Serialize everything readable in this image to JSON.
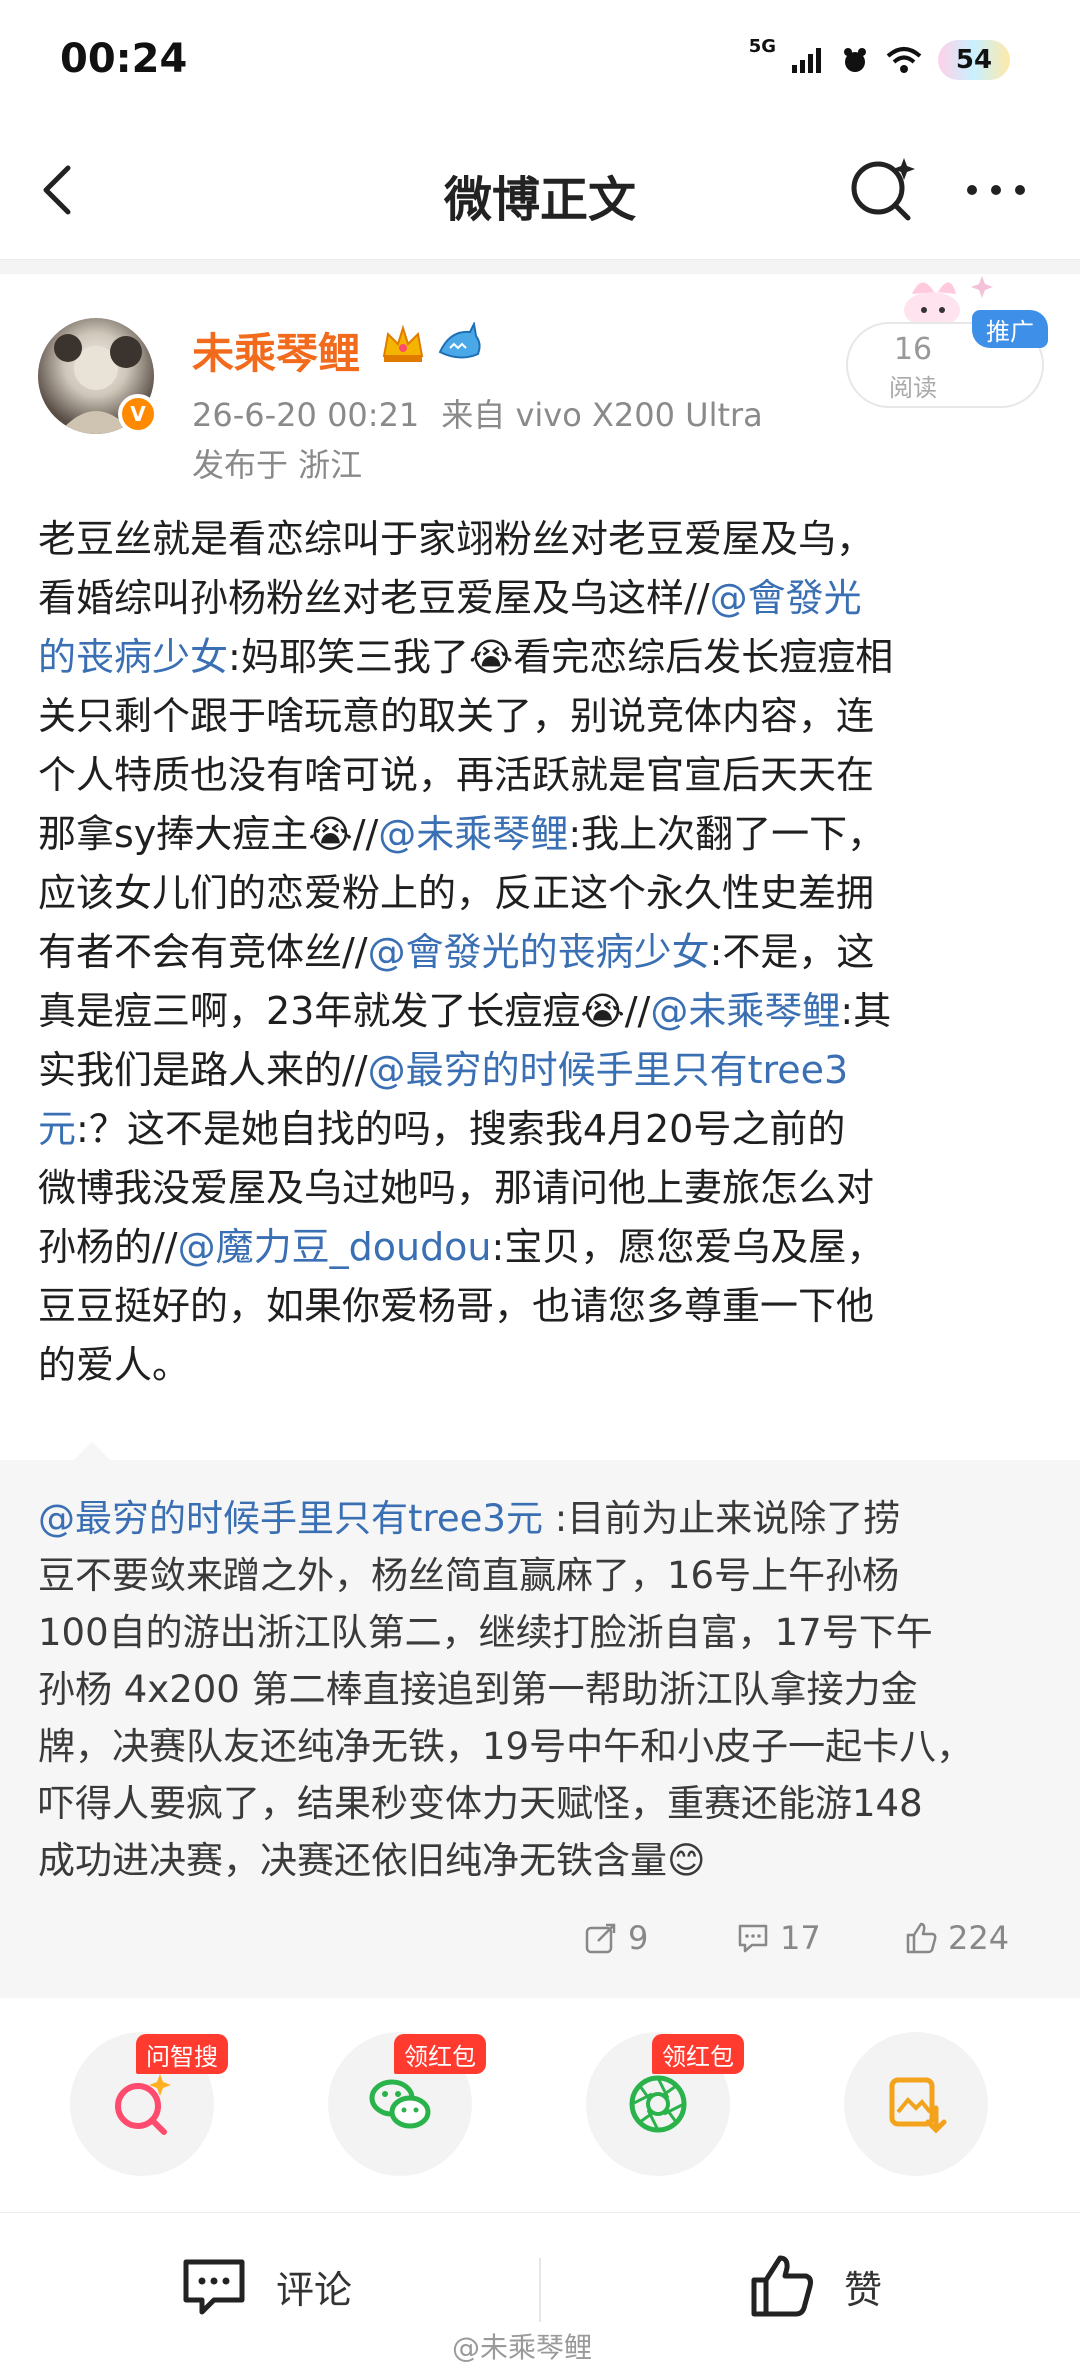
{
  "status_bar": {
    "time": "00:24",
    "network": "5G",
    "battery": "54"
  },
  "header": {
    "title": "微博正文"
  },
  "author": {
    "name": "未乘琴鲤",
    "timestamp": "26-6-20 00:21",
    "source": "来自 vivo X200 Ultra",
    "location": "发布于 浙江"
  },
  "stats_box": {
    "count": "16",
    "label": "阅读",
    "promo": "推广"
  },
  "post": {
    "lines": [
      [
        {
          "t": "老豆丝就是看恋综叫于家翊粉丝对老豆爱屋及乌，"
        }
      ],
      [
        {
          "t": "看婚综叫孙杨粉丝对老豆爱屋及乌这样//"
        },
        {
          "t": "@會發光",
          "at": true
        }
      ],
      [
        {
          "t": "的丧病少女",
          "at": true
        },
        {
          "t": ":妈耶笑三我了😭看完恋综后发长痘痘相"
        }
      ],
      [
        {
          "t": "关只剩个跟于啥玩意的取关了，别说竞体内容，连"
        }
      ],
      [
        {
          "t": "个人特质也没有啥可说，再活跃就是官宣后天天在"
        }
      ],
      [
        {
          "t": "那拿sy捧大痘主😭//"
        },
        {
          "t": "@未乘琴鲤",
          "at": true
        },
        {
          "t": ":我上次翻了一下，"
        }
      ],
      [
        {
          "t": "应该女儿们的恋爱粉上的，反正这个永久性史差拥"
        }
      ],
      [
        {
          "t": "有者不会有竞体丝//"
        },
        {
          "t": "@會發光的丧病少女",
          "at": true
        },
        {
          "t": ":不是，这"
        }
      ],
      [
        {
          "t": "真是痘三啊，23年就发了长痘痘😭//"
        },
        {
          "t": "@未乘琴鲤",
          "at": true
        },
        {
          "t": ":其"
        }
      ],
      [
        {
          "t": "实我们是路人来的//"
        },
        {
          "t": "@最穷的时候手里只有tree3",
          "at": true
        }
      ],
      [
        {
          "t": "元",
          "at": true
        },
        {
          "t": ":？这不是她自找的吗，搜索我4月20号之前的"
        }
      ],
      [
        {
          "t": "微博我没爱屋及乌过她吗，那请问他上妻旅怎么对"
        }
      ],
      [
        {
          "t": "孙杨的//"
        },
        {
          "t": "@魔力豆_doudou",
          "at": true
        },
        {
          "t": ":宝贝，愿您爱乌及屋，"
        }
      ],
      [
        {
          "t": "豆豆挺好的，如果你爱杨哥，也请您多尊重一下他"
        }
      ],
      [
        {
          "t": "的爱人。"
        }
      ]
    ]
  },
  "quoted": {
    "lines": [
      [
        {
          "t": "@最穷的时候手里只有tree3元",
          "at": true
        },
        {
          "t": " :目前为止来说除了捞"
        }
      ],
      [
        {
          "t": "豆不要敛来蹭之外，杨丝简直赢麻了，16号上午孙杨"
        }
      ],
      [
        {
          "t": "100自的游出浙江队第二，继续打脸浙自富，17号下午"
        }
      ],
      [
        {
          "t": "孙杨 4x200 第二棒直接追到第一帮助浙江队拿接力金"
        }
      ],
      [
        {
          "t": "牌，决赛队友还纯净无铁，19号中午和小皮子一起卡八，"
        }
      ],
      [
        {
          "t": "吓得人要疯了，结果秒变体力天赋怪，重赛还能游148"
        }
      ],
      [
        {
          "t": "成功进决赛，决赛还依旧纯净无铁含量😊"
        }
      ]
    ],
    "reposts": "9",
    "comments": "17",
    "likes": "224"
  },
  "app_row": {
    "items": [
      {
        "tag": "问智搜",
        "icon": "ai-search-icon"
      },
      {
        "tag": "领红包",
        "icon": "wechat-icon"
      },
      {
        "tag": "领红包",
        "icon": "moments-icon"
      },
      {
        "tag": "",
        "icon": "save-image-icon"
      }
    ]
  },
  "bottom_bar": {
    "comment_label": "评论",
    "like_label": "赞",
    "watermark": "@未乘琴鲤"
  },
  "colors": {
    "accent_orange": "#f26b1d",
    "link_blue": "#3a6fb3",
    "promo_blue": "#3d8fe8",
    "tag_red": "#ff3b30"
  }
}
